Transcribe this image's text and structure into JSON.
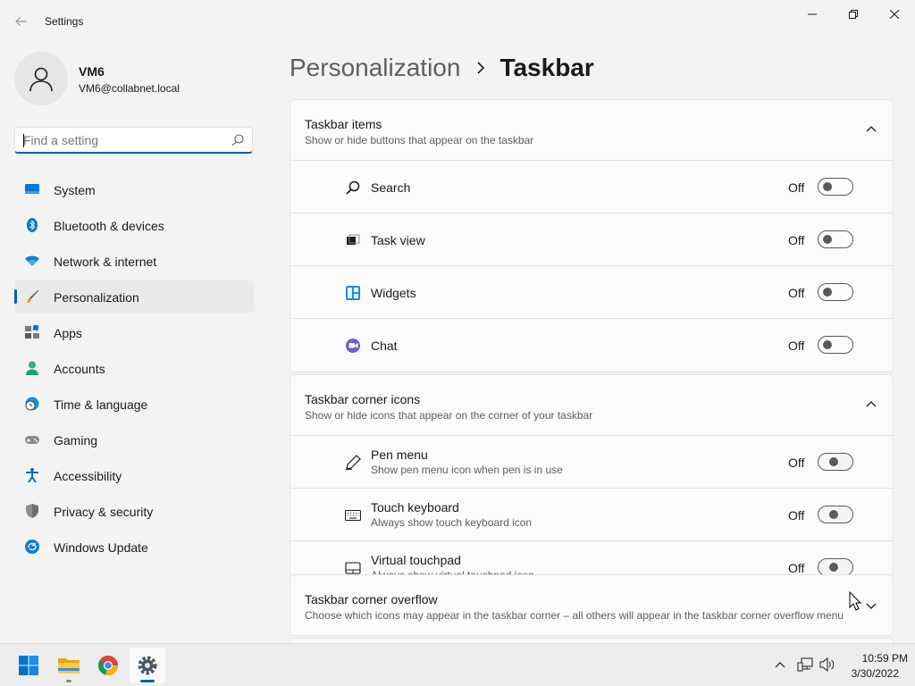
{
  "window": {
    "title": "Settings"
  },
  "user": {
    "name": "VM6",
    "email": "VM6@collabnet.local"
  },
  "search": {
    "placeholder": "Find a setting"
  },
  "sidebar": {
    "items": [
      {
        "label": "System",
        "icon": "monitor-icon",
        "active": false
      },
      {
        "label": "Bluetooth & devices",
        "icon": "bluetooth-icon",
        "active": false
      },
      {
        "label": "Network & internet",
        "icon": "wifi-icon",
        "active": false
      },
      {
        "label": "Personalization",
        "icon": "paintbrush-icon",
        "active": true
      },
      {
        "label": "Apps",
        "icon": "apps-icon",
        "active": false
      },
      {
        "label": "Accounts",
        "icon": "person-icon",
        "active": false
      },
      {
        "label": "Time & language",
        "icon": "globe-clock-icon",
        "active": false
      },
      {
        "label": "Gaming",
        "icon": "gamepad-icon",
        "active": false
      },
      {
        "label": "Accessibility",
        "icon": "accessibility-icon",
        "active": false
      },
      {
        "label": "Privacy & security",
        "icon": "shield-icon",
        "active": false
      },
      {
        "label": "Windows Update",
        "icon": "update-icon",
        "active": false
      }
    ]
  },
  "breadcrumb": {
    "parent": "Personalization",
    "current": "Taskbar"
  },
  "sections": {
    "taskbar_items": {
      "title": "Taskbar items",
      "subtitle": "Show or hide buttons that appear on the taskbar",
      "rows": [
        {
          "label": "Search",
          "state": "Off",
          "icon": "search-icon"
        },
        {
          "label": "Task view",
          "state": "Off",
          "icon": "task-view-icon"
        },
        {
          "label": "Widgets",
          "state": "Off",
          "icon": "widgets-icon"
        },
        {
          "label": "Chat",
          "state": "Off",
          "icon": "chat-icon"
        }
      ]
    },
    "corner_icons": {
      "title": "Taskbar corner icons",
      "subtitle": "Show or hide icons that appear on the corner of your taskbar",
      "rows": [
        {
          "label": "Pen menu",
          "sub": "Show pen menu icon when pen is in use",
          "state": "Off",
          "icon": "pen-icon"
        },
        {
          "label": "Touch keyboard",
          "sub": "Always show touch keyboard icon",
          "state": "Off",
          "icon": "keyboard-icon"
        },
        {
          "label": "Virtual touchpad",
          "sub": "Always show virtual touchpad icon",
          "state": "Off",
          "icon": "touchpad-icon"
        }
      ]
    },
    "corner_overflow": {
      "title": "Taskbar corner overflow",
      "subtitle": "Choose which icons may appear in the taskbar corner – all others will appear in the taskbar corner overflow menu"
    }
  },
  "taskbar": {
    "apps": [
      {
        "name": "start-button"
      },
      {
        "name": "file-explorer"
      },
      {
        "name": "chrome"
      },
      {
        "name": "settings"
      }
    ],
    "clock": {
      "time": "10:59 PM",
      "date": "3/30/2022"
    }
  },
  "colors": {
    "accent": "#005fb8",
    "background": "#f3f3f3",
    "card": "#fbfbfb"
  }
}
